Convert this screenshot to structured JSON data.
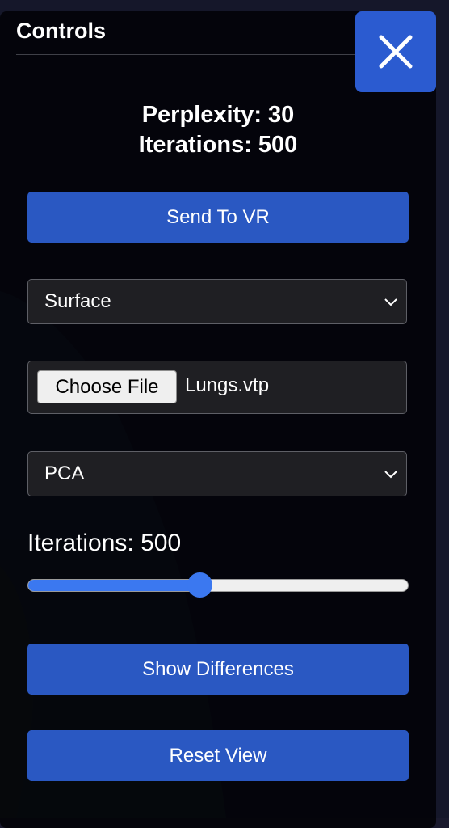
{
  "panel": {
    "title": "Controls"
  },
  "info": {
    "perplexity": "Perplexity: 30",
    "iterations": "Iterations: 500"
  },
  "buttons": {
    "send_to_vr": "Send To VR",
    "show_differences": "Show Differences",
    "reset_view": "Reset View"
  },
  "selects": {
    "render_mode": "Surface",
    "reduction_method": "PCA"
  },
  "file_input": {
    "button_label": "Choose File",
    "file_name": "Lungs.vtp"
  },
  "slider": {
    "label": "Iterations: 500",
    "fraction": 0.45
  },
  "colors": {
    "accent": "#2a58c2",
    "close_button": "#2b5bd0",
    "slider_fill": "#3b78f0",
    "panel_bg": "#04040a"
  },
  "icons": {
    "close": "close-icon",
    "dropdown": "chevron-down-icon"
  }
}
